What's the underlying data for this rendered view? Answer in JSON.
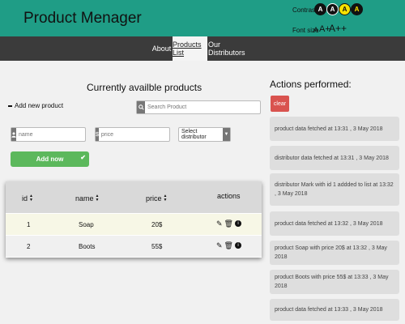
{
  "header": {
    "title": "Product Menager",
    "contrast_label": "Contrast",
    "contrast_options": [
      "A",
      "A",
      "A",
      "A"
    ],
    "font_size_label": "Font size",
    "font_sizes": [
      "A",
      "A+",
      "A++"
    ]
  },
  "nav": {
    "items": [
      {
        "label": "About"
      },
      {
        "label": "Products List"
      },
      {
        "label": "Our Distributors"
      }
    ],
    "active": "Products List"
  },
  "products_panel": {
    "heading": "Currently availble products",
    "add_new_label": "Add new product",
    "search_placeholder": "Search Product",
    "form": {
      "name_placeholder": "name",
      "name_value": "",
      "price_addon": "$",
      "price_placeholder": "price",
      "price_value": "",
      "distributor_selected": "Select distributor",
      "add_button_label": "Add now"
    },
    "table": {
      "columns": [
        "id",
        "name",
        "price",
        "actions"
      ],
      "rows": [
        {
          "id": "1",
          "name": "Soap",
          "price": "20$"
        },
        {
          "id": "2",
          "name": "Boots",
          "price": "55$"
        }
      ]
    }
  },
  "actions_panel": {
    "heading": "Actions performed:",
    "clear_label": "clear",
    "log": [
      "product data fetched at 13:31 , 3 May 2018",
      "distributor data fetched at 13:31 , 3 May 2018",
      "distributor Mark with id 1 addded to list at 13:32 , 3 May 2018",
      "product data fetched at 13:32 , 3 May 2018",
      "product Soap with price 20$ at 13:32 , 3 May 2018",
      "product Boots with price 55$ at 13:33 , 3 May 2018",
      "product data fetched at 13:33 , 3 May 2018"
    ]
  },
  "colors": {
    "header": "#1f9d86",
    "nav": "#3b3b3b",
    "add_button": "#5cb85c",
    "clear_button": "#d9534f"
  },
  "icons": [
    "search-icon",
    "user-icon",
    "caret-down-icon",
    "check-icon",
    "sort-icon",
    "edit-icon",
    "delete-icon",
    "info-icon"
  ]
}
